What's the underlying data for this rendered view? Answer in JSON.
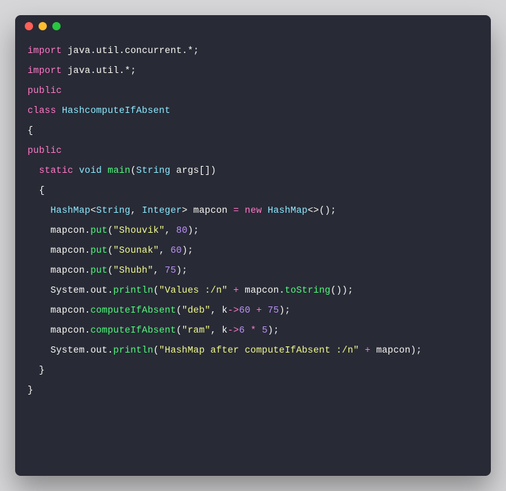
{
  "window": {
    "traffic_lights": [
      "close",
      "minimize",
      "zoom"
    ]
  },
  "code": {
    "lines": [
      [
        {
          "t": "import",
          "c": "kw"
        },
        {
          "t": " ",
          "c": "plain"
        },
        {
          "t": "java",
          "c": "plain"
        },
        {
          "t": ".",
          "c": "punc"
        },
        {
          "t": "util",
          "c": "plain"
        },
        {
          "t": ".",
          "c": "punc"
        },
        {
          "t": "concurrent",
          "c": "plain"
        },
        {
          "t": ".*;",
          "c": "punc"
        }
      ],
      [
        {
          "t": "import",
          "c": "kw"
        },
        {
          "t": " ",
          "c": "plain"
        },
        {
          "t": "java",
          "c": "plain"
        },
        {
          "t": ".",
          "c": "punc"
        },
        {
          "t": "util",
          "c": "plain"
        },
        {
          "t": ".*;",
          "c": "punc"
        }
      ],
      [
        {
          "t": "public",
          "c": "kw"
        }
      ],
      [
        {
          "t": "class ",
          "c": "kw"
        },
        {
          "t": "HashcomputeIfAbsent",
          "c": "type"
        }
      ],
      [
        {
          "t": "{",
          "c": "punc"
        }
      ],
      [
        {
          "t": "public",
          "c": "kw"
        }
      ],
      [
        {
          "t": "  ",
          "c": "plain"
        },
        {
          "t": "static",
          "c": "kw"
        },
        {
          "t": " ",
          "c": "plain"
        },
        {
          "t": "void",
          "c": "type"
        },
        {
          "t": " ",
          "c": "plain"
        },
        {
          "t": "main",
          "c": "fn"
        },
        {
          "t": "(",
          "c": "punc"
        },
        {
          "t": "String",
          "c": "type"
        },
        {
          "t": " args",
          "c": "plain"
        },
        {
          "t": "[])",
          "c": "punc"
        }
      ],
      [
        {
          "t": "  {",
          "c": "punc"
        }
      ],
      [
        {
          "t": "    ",
          "c": "plain"
        },
        {
          "t": "HashMap",
          "c": "type"
        },
        {
          "t": "<",
          "c": "punc"
        },
        {
          "t": "String",
          "c": "type"
        },
        {
          "t": ", ",
          "c": "punc"
        },
        {
          "t": "Integer",
          "c": "type"
        },
        {
          "t": ">",
          "c": "punc"
        },
        {
          "t": " mapcon ",
          "c": "plain"
        },
        {
          "t": "=",
          "c": "op"
        },
        {
          "t": " ",
          "c": "plain"
        },
        {
          "t": "new",
          "c": "kw"
        },
        {
          "t": " ",
          "c": "plain"
        },
        {
          "t": "HashMap",
          "c": "type"
        },
        {
          "t": "<>",
          "c": "punc"
        },
        {
          "t": "();",
          "c": "punc"
        }
      ],
      [
        {
          "t": "    mapcon",
          "c": "plain"
        },
        {
          "t": ".",
          "c": "punc"
        },
        {
          "t": "put",
          "c": "fn"
        },
        {
          "t": "(",
          "c": "punc"
        },
        {
          "t": "\"Shouvik\"",
          "c": "str"
        },
        {
          "t": ", ",
          "c": "punc"
        },
        {
          "t": "80",
          "c": "num"
        },
        {
          "t": ");",
          "c": "punc"
        }
      ],
      [
        {
          "t": "    mapcon",
          "c": "plain"
        },
        {
          "t": ".",
          "c": "punc"
        },
        {
          "t": "put",
          "c": "fn"
        },
        {
          "t": "(",
          "c": "punc"
        },
        {
          "t": "\"Sounak\"",
          "c": "str"
        },
        {
          "t": ", ",
          "c": "punc"
        },
        {
          "t": "60",
          "c": "num"
        },
        {
          "t": ");",
          "c": "punc"
        }
      ],
      [
        {
          "t": "    mapcon",
          "c": "plain"
        },
        {
          "t": ".",
          "c": "punc"
        },
        {
          "t": "put",
          "c": "fn"
        },
        {
          "t": "(",
          "c": "punc"
        },
        {
          "t": "\"Shubh\"",
          "c": "str"
        },
        {
          "t": ", ",
          "c": "punc"
        },
        {
          "t": "75",
          "c": "num"
        },
        {
          "t": ");",
          "c": "punc"
        }
      ],
      [
        {
          "t": "    System",
          "c": "plain"
        },
        {
          "t": ".",
          "c": "punc"
        },
        {
          "t": "out",
          "c": "plain"
        },
        {
          "t": ".",
          "c": "punc"
        },
        {
          "t": "println",
          "c": "fn"
        },
        {
          "t": "(",
          "c": "punc"
        },
        {
          "t": "\"Values :/n\"",
          "c": "str"
        },
        {
          "t": " ",
          "c": "plain"
        },
        {
          "t": "+",
          "c": "op"
        },
        {
          "t": " mapcon",
          "c": "plain"
        },
        {
          "t": ".",
          "c": "punc"
        },
        {
          "t": "toString",
          "c": "fn"
        },
        {
          "t": "());",
          "c": "punc"
        }
      ],
      [
        {
          "t": "    mapcon",
          "c": "plain"
        },
        {
          "t": ".",
          "c": "punc"
        },
        {
          "t": "computeIfAbsent",
          "c": "fn"
        },
        {
          "t": "(",
          "c": "punc"
        },
        {
          "t": "\"deb\"",
          "c": "str"
        },
        {
          "t": ", k",
          "c": "plain"
        },
        {
          "t": "->",
          "c": "op"
        },
        {
          "t": "60",
          "c": "num"
        },
        {
          "t": " ",
          "c": "plain"
        },
        {
          "t": "+",
          "c": "op"
        },
        {
          "t": " ",
          "c": "plain"
        },
        {
          "t": "75",
          "c": "num"
        },
        {
          "t": ");",
          "c": "punc"
        }
      ],
      [
        {
          "t": "    mapcon",
          "c": "plain"
        },
        {
          "t": ".",
          "c": "punc"
        },
        {
          "t": "computeIfAbsent",
          "c": "fn"
        },
        {
          "t": "(",
          "c": "punc"
        },
        {
          "t": "\"ram\"",
          "c": "str"
        },
        {
          "t": ", k",
          "c": "plain"
        },
        {
          "t": "->",
          "c": "op"
        },
        {
          "t": "6",
          "c": "num"
        },
        {
          "t": " ",
          "c": "plain"
        },
        {
          "t": "*",
          "c": "op"
        },
        {
          "t": " ",
          "c": "plain"
        },
        {
          "t": "5",
          "c": "num"
        },
        {
          "t": ");",
          "c": "punc"
        }
      ],
      [
        {
          "t": "    System",
          "c": "plain"
        },
        {
          "t": ".",
          "c": "punc"
        },
        {
          "t": "out",
          "c": "plain"
        },
        {
          "t": ".",
          "c": "punc"
        },
        {
          "t": "println",
          "c": "fn"
        },
        {
          "t": "(",
          "c": "punc"
        },
        {
          "t": "\"HashMap after computeIfAbsent :/n\"",
          "c": "str"
        },
        {
          "t": " ",
          "c": "plain"
        },
        {
          "t": "+",
          "c": "op"
        },
        {
          "t": " mapcon",
          "c": "plain"
        },
        {
          "t": ");",
          "c": "punc"
        }
      ],
      [
        {
          "t": "  }",
          "c": "punc"
        }
      ],
      [
        {
          "t": "}",
          "c": "punc"
        }
      ]
    ]
  }
}
